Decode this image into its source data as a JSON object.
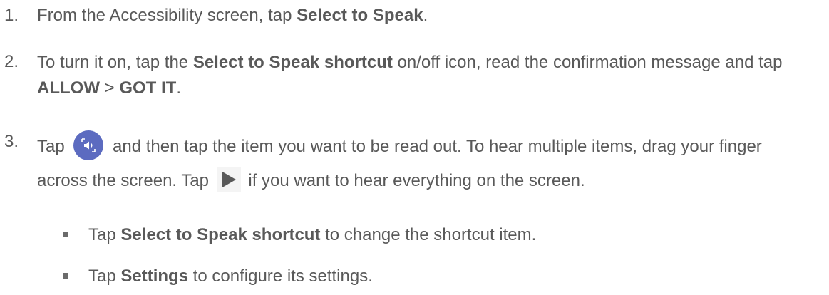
{
  "steps": [
    {
      "number": "1.",
      "parts": {
        "t1": "From the Accessibility screen, tap ",
        "b1": "Select to Speak",
        "t2": "."
      }
    },
    {
      "number": "2.",
      "parts": {
        "t1": "To turn it on, tap the ",
        "b1": "Select to Speak shortcut",
        "t2": " on/off icon, read the confirmation message and tap ",
        "b2": "ALLOW",
        "t3": " > ",
        "b3": "GOT IT",
        "t4": "."
      }
    },
    {
      "number": "3.",
      "parts": {
        "t1": "Tap ",
        "t2": " and then tap the item you want to be read out. To hear multiple items, drag your finger across the screen. Tap ",
        "t3": " if you want to hear everything on the screen."
      }
    }
  ],
  "bullets": [
    {
      "t1": "Tap ",
      "b1": "Select to Speak shortcut",
      "t2": " to change the shortcut item."
    },
    {
      "t1": "Tap ",
      "b1": "Settings",
      "t2": " to configure its settings."
    }
  ],
  "icons": {
    "speak": "select-to-speak-icon",
    "play": "play-icon"
  },
  "colors": {
    "text": "#595959",
    "speak_icon_bg": "#5c6bc0"
  }
}
